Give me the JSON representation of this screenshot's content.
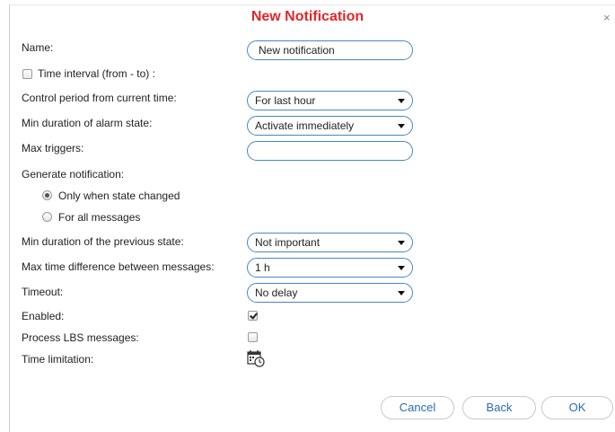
{
  "dialog": {
    "title": "New Notification",
    "close_glyph": "×"
  },
  "form": {
    "name_label": "Name:",
    "name_value": "New notification",
    "time_interval_label": "Time interval (from - to) :",
    "time_interval_checked": false,
    "control_period_label": "Control period from current time:",
    "control_period_value": "For last hour",
    "min_duration_alarm_label": "Min duration of alarm state:",
    "min_duration_alarm_value": "Activate immediately",
    "max_triggers_label": "Max triggers:",
    "max_triggers_value": "",
    "generate_label": "Generate notification:",
    "generate_options": [
      {
        "label": "Only when state changed",
        "selected": true
      },
      {
        "label": "For all messages",
        "selected": false
      }
    ],
    "min_duration_prev_label": "Min duration of the previous state:",
    "min_duration_prev_value": "Not important",
    "max_time_diff_label": "Max time difference between messages:",
    "max_time_diff_value": "1 h",
    "timeout_label": "Timeout:",
    "timeout_value": "No delay",
    "enabled_label": "Enabled:",
    "enabled_checked": true,
    "process_lbs_label": "Process LBS messages:",
    "process_lbs_checked": false,
    "time_limitation_label": "Time limitation:",
    "time_limitation_icon": "calendar-clock-icon"
  },
  "buttons": {
    "cancel": "Cancel",
    "back": "Back",
    "ok": "OK"
  },
  "colors": {
    "title": "#e2262a",
    "accent": "#4a86c5",
    "button_text": "#2b6cb3"
  }
}
